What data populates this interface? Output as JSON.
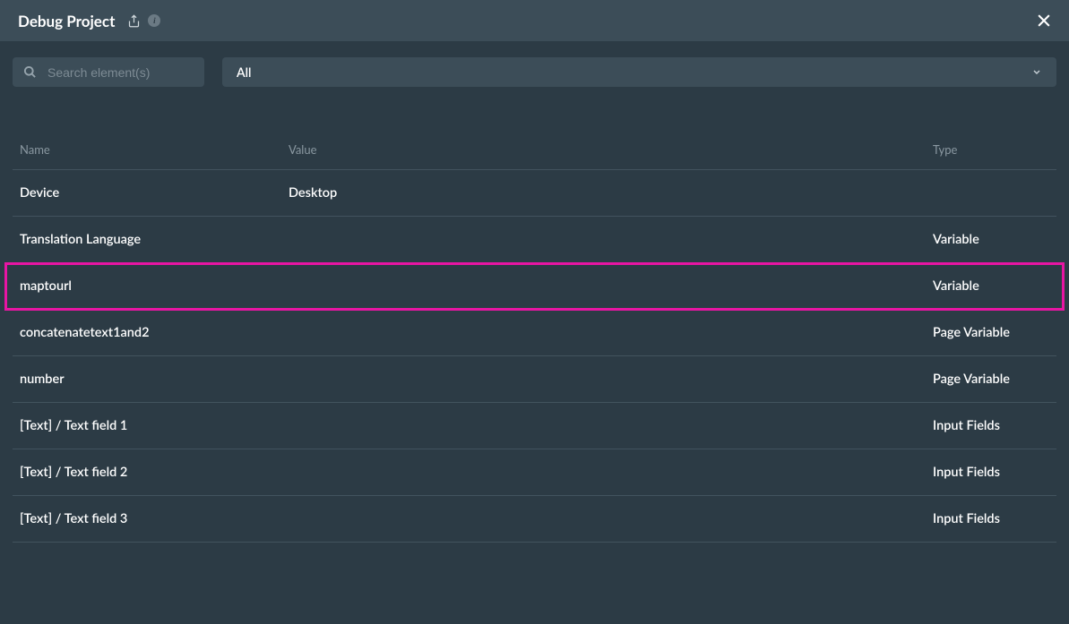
{
  "header": {
    "title": "Debug Project",
    "info_label": "i"
  },
  "filters": {
    "search_placeholder": "Search element(s)",
    "dropdown_selected": "All"
  },
  "table": {
    "columns": {
      "name": "Name",
      "value": "Value",
      "type": "Type"
    },
    "rows": [
      {
        "name": "Device",
        "value": "Desktop",
        "type": "",
        "highlight": false
      },
      {
        "name": "Translation Language",
        "value": "",
        "type": "Variable",
        "highlight": false
      },
      {
        "name": "maptourl",
        "value": "",
        "type": "Variable",
        "highlight": true
      },
      {
        "name": "concatenatetext1and2",
        "value": "",
        "type": "Page Variable",
        "highlight": false
      },
      {
        "name": "number",
        "value": "",
        "type": "Page Variable",
        "highlight": false
      },
      {
        "name": "[Text] / Text field 1",
        "value": "",
        "type": "Input Fields",
        "highlight": false
      },
      {
        "name": "[Text] / Text field 2",
        "value": "",
        "type": "Input Fields",
        "highlight": false
      },
      {
        "name": "[Text] / Text field 3",
        "value": "",
        "type": "Input Fields",
        "highlight": false
      }
    ]
  }
}
